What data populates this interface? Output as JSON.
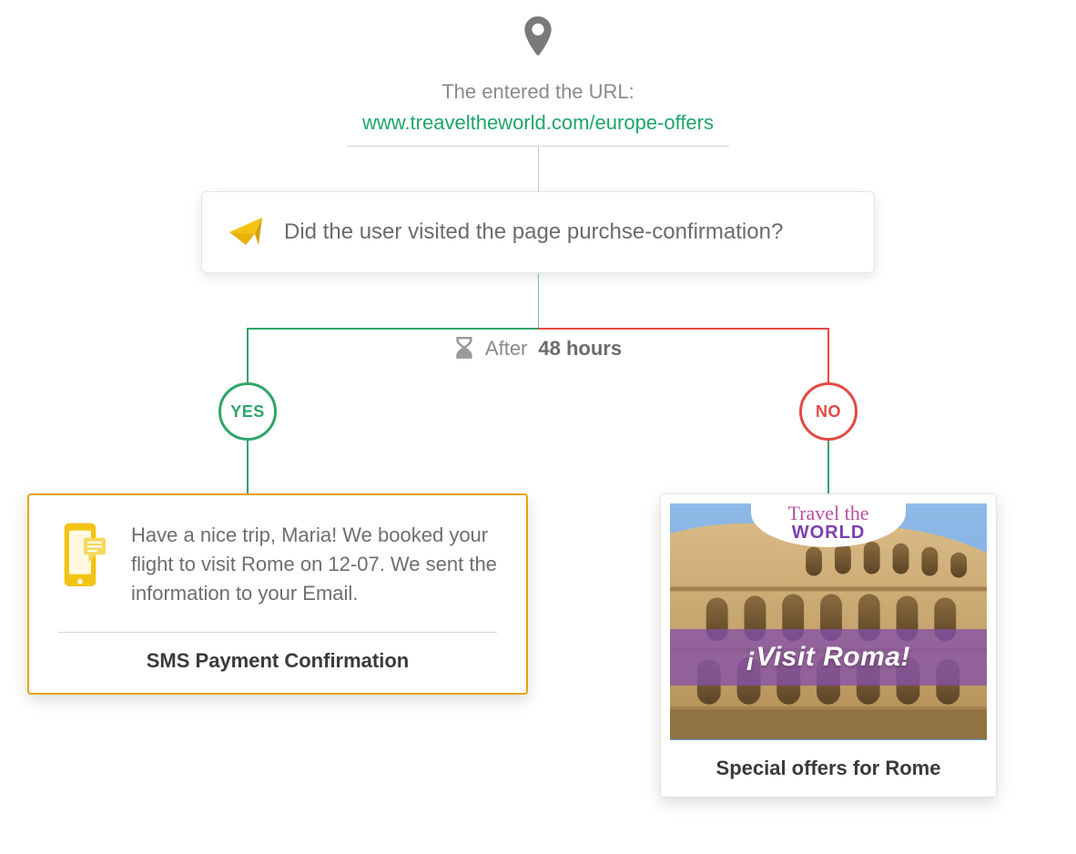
{
  "top": {
    "label": "The entered the URL:",
    "url": "www.treaveltheworld.com/europe-offers"
  },
  "question": {
    "text": "Did the user visited the page purchse-confirmation?"
  },
  "delay": {
    "prefix": "After",
    "value": "48 hours"
  },
  "branches": {
    "yes_label": "YES",
    "no_label": "NO"
  },
  "sms_card": {
    "message": "Have a nice trip, Maria! We booked your flight to visit Rome on 12-07. We sent the information to your Email.",
    "title": "SMS Payment Confirmation"
  },
  "promo_card": {
    "brand_line1": "Travel the",
    "brand_line2": "WORLD",
    "banner": "¡Visit Roma!",
    "caption": "Special offers for Rome"
  },
  "colors": {
    "green": "#2fa56b",
    "red": "#e24a42",
    "orange": "#e8a20e",
    "purple": "#7b3fb0",
    "text_muted": "#8a8a8a"
  }
}
